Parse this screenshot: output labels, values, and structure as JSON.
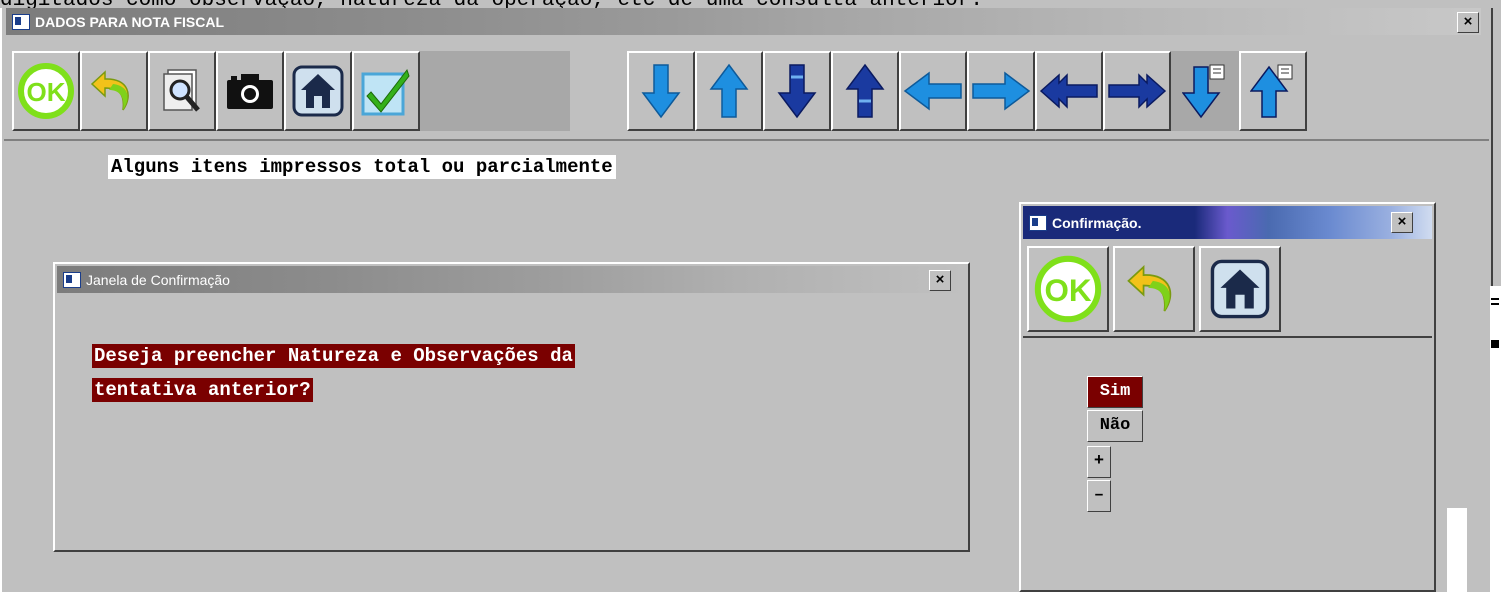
{
  "top_cut_text": "digitados como observação, natureza da operação, etc de uma consulta anterior.",
  "main_window": {
    "title": "DADOS PARA NOTA FISCAL",
    "close_label": "×"
  },
  "toolbar": {
    "buttons": [
      {
        "name": "ok",
        "icon": "ok-icon",
        "label": "OK"
      },
      {
        "name": "back",
        "icon": "undo-arrow-icon"
      },
      {
        "name": "search",
        "icon": "magnifier-icon"
      },
      {
        "name": "camera",
        "icon": "camera-icon"
      },
      {
        "name": "home",
        "icon": "home-icon"
      },
      {
        "name": "check",
        "icon": "checkmark-icon"
      },
      {
        "name": "blank",
        "icon": "none"
      },
      {
        "name": "down",
        "icon": "arrow-down-icon"
      },
      {
        "name": "up",
        "icon": "arrow-up-icon"
      },
      {
        "name": "down-dark",
        "icon": "arrow-down-dark-icon"
      },
      {
        "name": "up-dark",
        "icon": "arrow-up-dark-icon"
      },
      {
        "name": "left",
        "icon": "arrow-left-icon"
      },
      {
        "name": "right",
        "icon": "arrow-right-icon"
      },
      {
        "name": "first",
        "icon": "double-arrow-left-icon"
      },
      {
        "name": "last",
        "icon": "double-arrow-right-icon"
      },
      {
        "name": "page-down",
        "icon": "page-down-icon"
      },
      {
        "name": "page-up",
        "icon": "page-up-icon"
      }
    ]
  },
  "banner_text": "Alguns itens impressos total ou parcialmente",
  "confirm_window": {
    "title": "Janela de Confirmação",
    "close_label": "×",
    "message_line1": "Deseja preencher Natureza e Observações da",
    "message_line2": "tentativa anterior?"
  },
  "confirm_panel": {
    "title": "Confirmação.",
    "close_label": "×",
    "ok_label": "OK",
    "options": [
      "Sim",
      "Não",
      "+",
      "–"
    ],
    "selected": "Sim"
  },
  "colors": {
    "background": "#c0c0c0",
    "highlight": "#7a0000",
    "ok_green": "#7fe01a",
    "arrow_blue": "#1e8fe0",
    "arrow_dark": "#1a3aa0"
  }
}
